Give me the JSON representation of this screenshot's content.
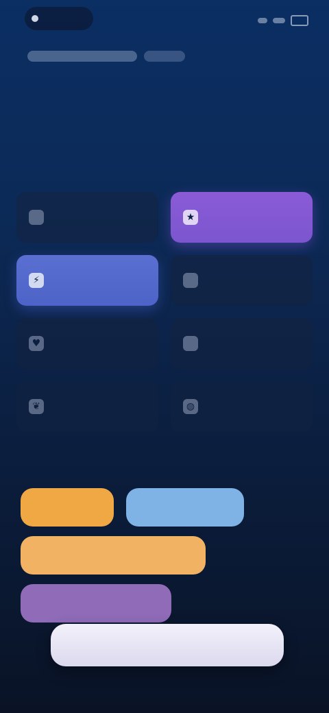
{
  "status_bar": {
    "brand": "",
    "indicators": [
      "signal",
      "wifi",
      "battery"
    ]
  },
  "meta": {
    "pill_a": "",
    "pill_b": ""
  },
  "page": {
    "headline": "",
    "section_label": ""
  },
  "options": [
    {
      "label": "",
      "icon": "circle-icon",
      "selected": false
    },
    {
      "label": "",
      "icon": "star-icon",
      "selected": true,
      "accent": "#7b56cf"
    },
    {
      "label": "",
      "icon": "bolt-icon",
      "selected": true,
      "accent": "#4d63c7"
    },
    {
      "label": "",
      "icon": "circle-icon",
      "selected": false
    },
    {
      "label": "",
      "icon": "heart-icon",
      "selected": false
    },
    {
      "label": "",
      "icon": "circle-icon",
      "selected": false
    },
    {
      "label": "",
      "icon": "leaf-icon",
      "selected": false
    },
    {
      "label": "",
      "icon": "globe-icon",
      "selected": false
    }
  ],
  "tags": [
    {
      "label": "",
      "color": "#f0a845"
    },
    {
      "label": "",
      "color": "#7fb3e6"
    },
    {
      "label": "",
      "color": "#f1b264"
    },
    {
      "label": "",
      "color": "#8f6bb8"
    }
  ],
  "cta": {
    "label": ""
  },
  "colors": {
    "bg_top": "#0b2e63",
    "bg_bottom": "#0a1326",
    "accent_purple": "#7b56cf",
    "accent_blue": "#4d63c7"
  }
}
